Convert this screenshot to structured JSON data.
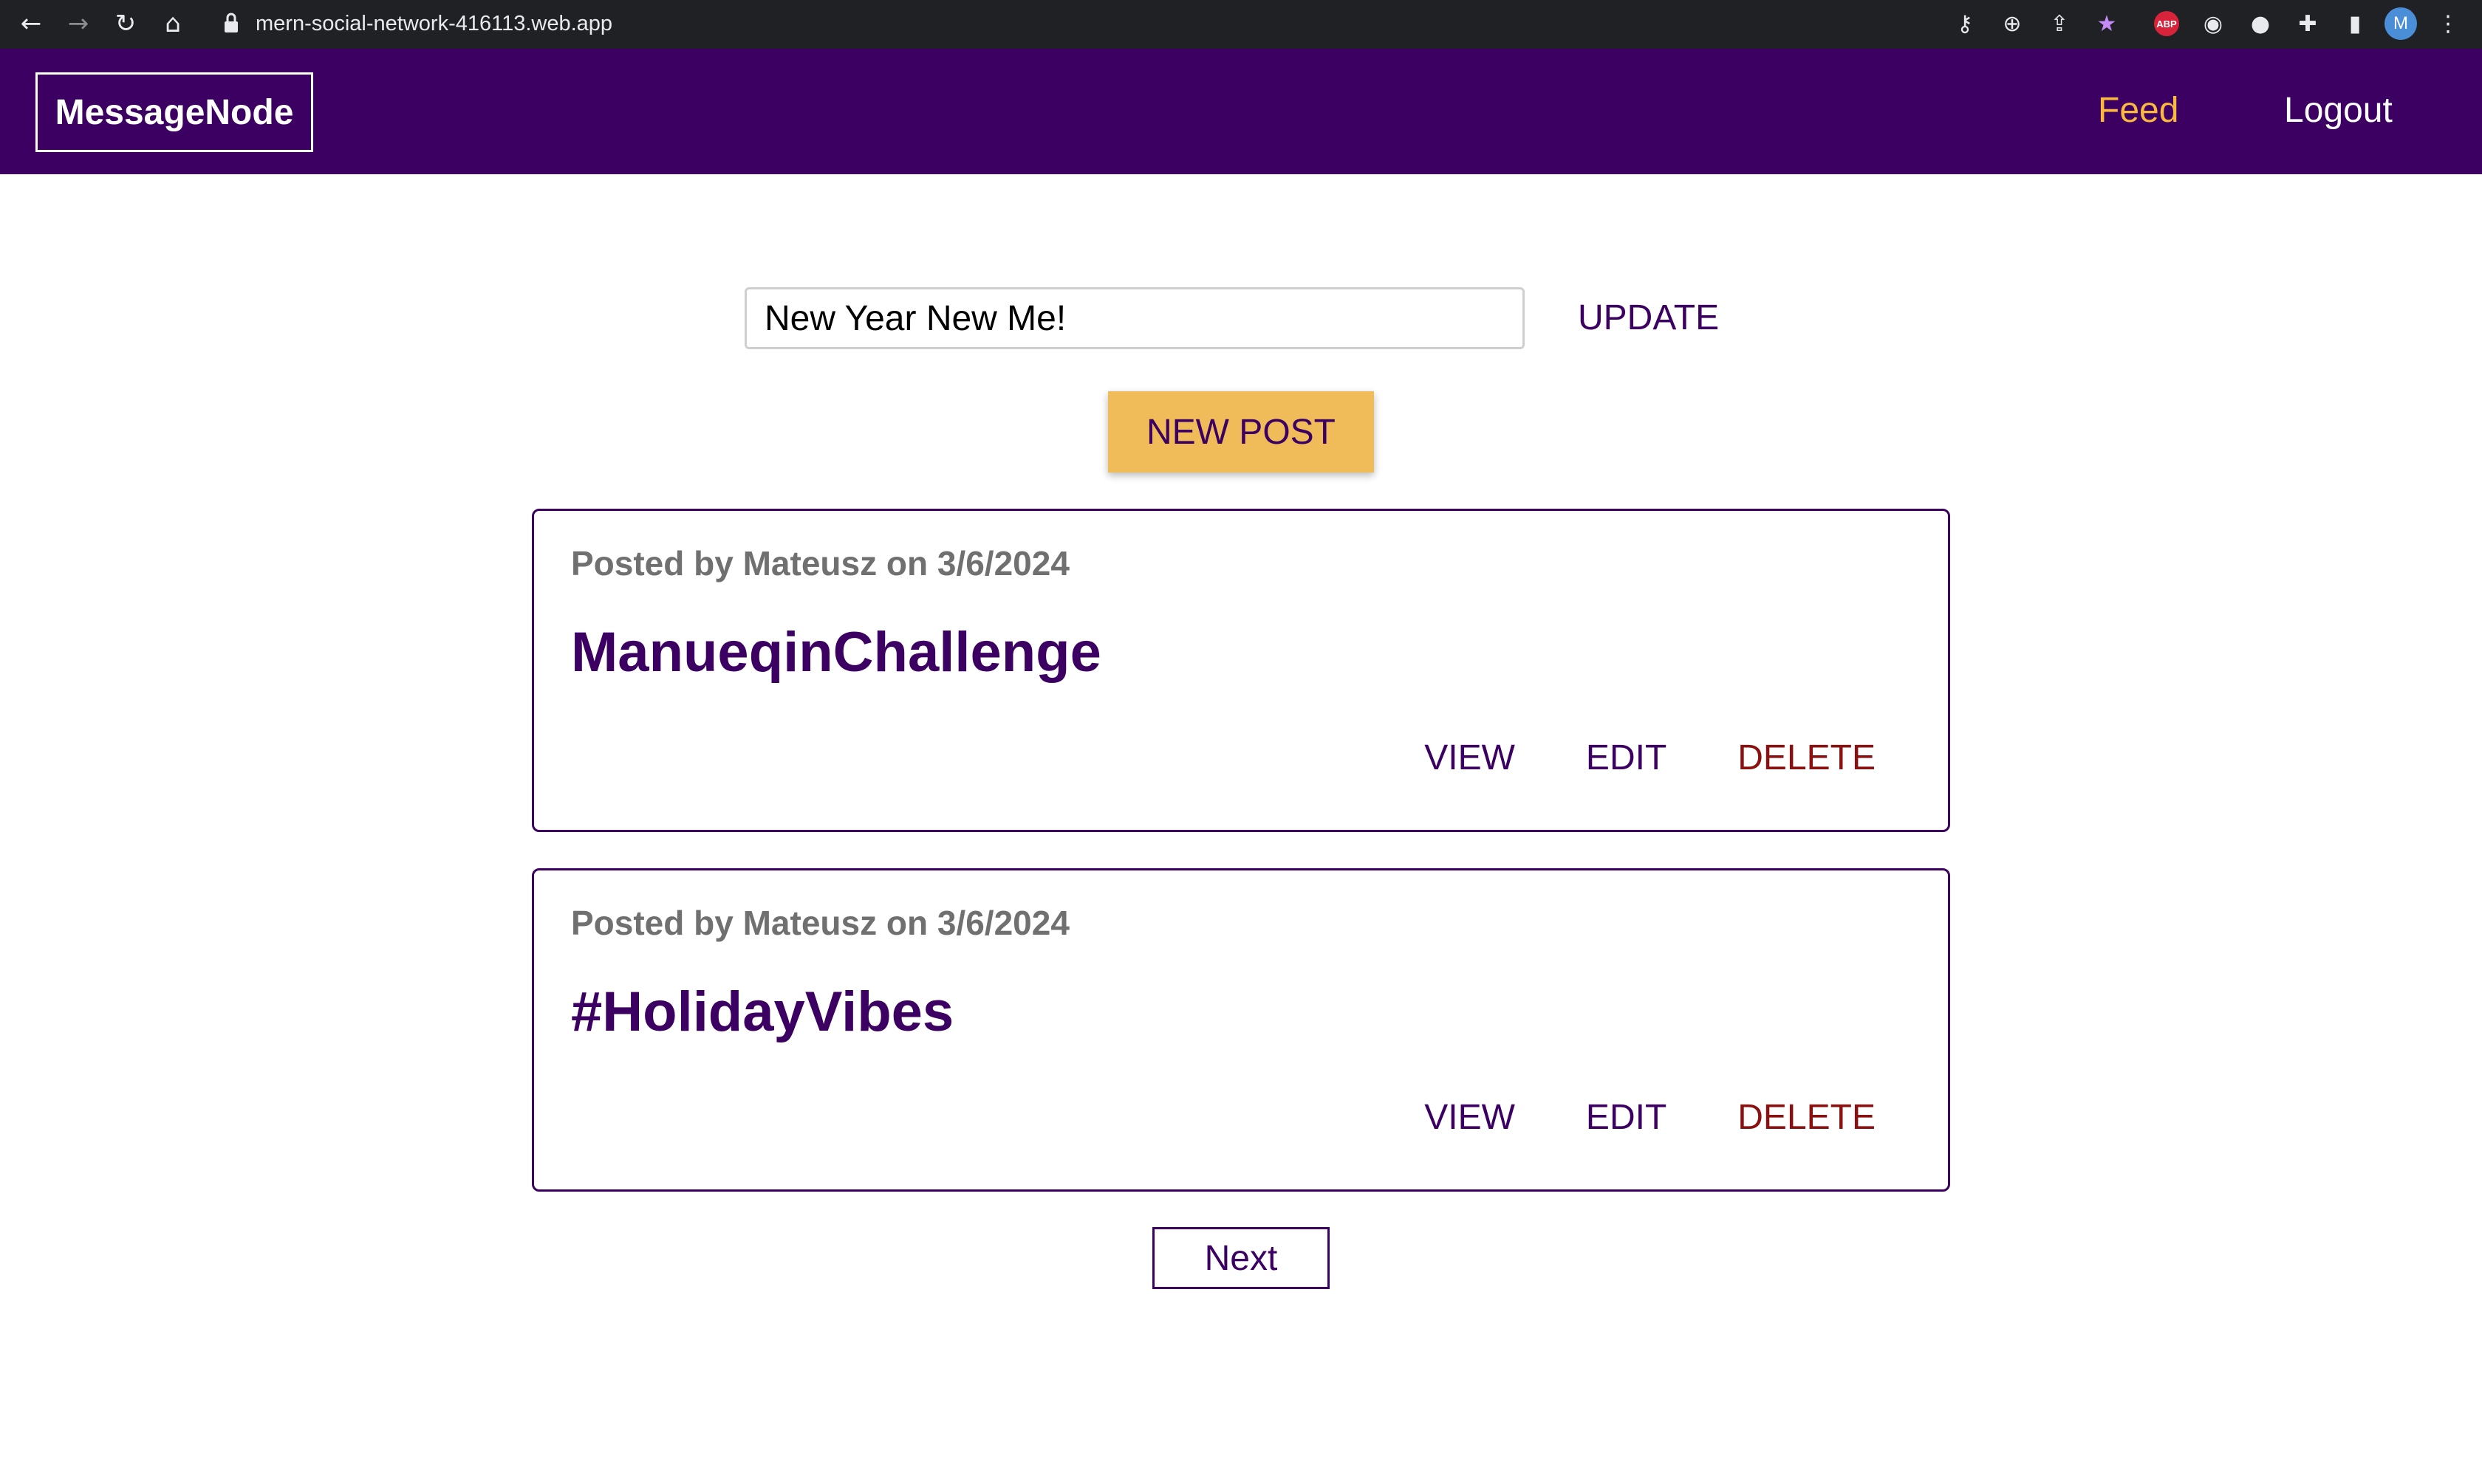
{
  "browser": {
    "url": "mern-social-network-416113.web.app",
    "profile_initial": "M",
    "abp_label": "ABP"
  },
  "header": {
    "logo": "MessageNode",
    "nav": {
      "feed": "Feed",
      "logout": "Logout"
    },
    "colors": {
      "background": "#3b0062",
      "active_link": "#fab83f"
    }
  },
  "status": {
    "value": "New Year New Me!",
    "update_label": "UPDATE"
  },
  "new_post_label": "NEW POST",
  "posts": [
    {
      "meta": "Posted by Mateusz on 3/6/2024",
      "title": "ManueqinChallenge",
      "view": "VIEW",
      "edit": "EDIT",
      "delete": "DELETE"
    },
    {
      "meta": "Posted by Mateusz on 3/6/2024",
      "title": "#HolidayVibes",
      "view": "VIEW",
      "edit": "EDIT",
      "delete": "DELETE"
    }
  ],
  "pagination": {
    "next_label": "Next"
  }
}
